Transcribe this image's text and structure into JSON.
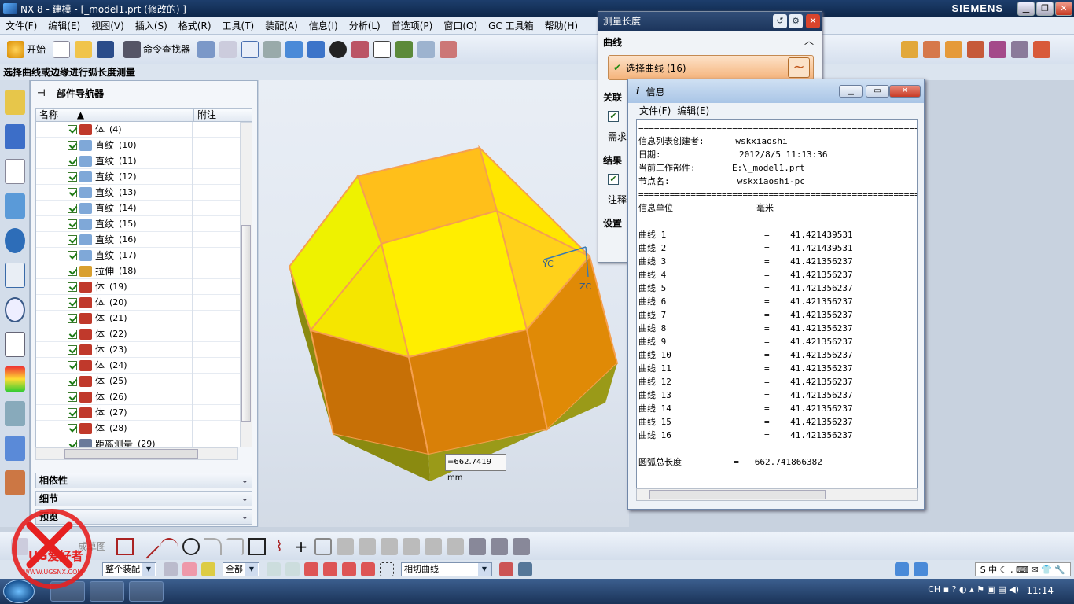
{
  "window": {
    "title": "NX 8 - 建模 - [_model1.prt (修改的) ]",
    "brand": "SIEMENS"
  },
  "menus": [
    "文件(F)",
    "编辑(E)",
    "视图(V)",
    "插入(S)",
    "格式(R)",
    "工具(T)",
    "装配(A)",
    "信息(I)",
    "分析(L)",
    "首选项(P)",
    "窗口(O)",
    "GC 工具箱",
    "帮助(H)"
  ],
  "toolbar": {
    "start_label": "开始",
    "command_finder_label": "命令查找器"
  },
  "status_prompt": "选择曲线或边缘进行弧长度测量",
  "navigator": {
    "title": "部件导航器",
    "col_name": "名称",
    "col_note": "附注",
    "rows": [
      {
        "label": "体",
        "id": "(4)",
        "kind": "body"
      },
      {
        "label": "直纹",
        "id": "(10)",
        "kind": "ruled"
      },
      {
        "label": "直纹",
        "id": "(11)",
        "kind": "ruled"
      },
      {
        "label": "直纹",
        "id": "(12)",
        "kind": "ruled"
      },
      {
        "label": "直纹",
        "id": "(13)",
        "kind": "ruled"
      },
      {
        "label": "直纹",
        "id": "(14)",
        "kind": "ruled"
      },
      {
        "label": "直纹",
        "id": "(15)",
        "kind": "ruled"
      },
      {
        "label": "直纹",
        "id": "(16)",
        "kind": "ruled"
      },
      {
        "label": "直纹",
        "id": "(17)",
        "kind": "ruled"
      },
      {
        "label": "拉伸",
        "id": "(18)",
        "kind": "extrude"
      },
      {
        "label": "体",
        "id": "(19)",
        "kind": "body"
      },
      {
        "label": "体",
        "id": "(20)",
        "kind": "body"
      },
      {
        "label": "体",
        "id": "(21)",
        "kind": "body"
      },
      {
        "label": "体",
        "id": "(22)",
        "kind": "body"
      },
      {
        "label": "体",
        "id": "(23)",
        "kind": "body"
      },
      {
        "label": "体",
        "id": "(24)",
        "kind": "body"
      },
      {
        "label": "体",
        "id": "(25)",
        "kind": "body"
      },
      {
        "label": "体",
        "id": "(26)",
        "kind": "body"
      },
      {
        "label": "体",
        "id": "(27)",
        "kind": "body"
      },
      {
        "label": "体",
        "id": "(28)",
        "kind": "body"
      },
      {
        "label": "距离测量",
        "id": "(29)",
        "kind": "measure"
      }
    ],
    "panels": [
      "相依性",
      "细节",
      "预览"
    ]
  },
  "measure_dialog": {
    "title": "测量长度",
    "section_curve": "曲线",
    "select_curve": "选择曲线 (16)",
    "section_assoc": "关联",
    "need_label": "需求",
    "section_result": "结果",
    "note_label": "注释",
    "settings_label": "设置"
  },
  "viewport": {
    "measure_label": "=662.7419 mm",
    "axis_yc": "YC",
    "axis_zc": "ZC"
  },
  "info_window": {
    "title": "信息",
    "menu_file": "文件(F)",
    "menu_edit": "编辑(E)",
    "separator": "=============================================================",
    "creator_label": "信息列表创建者:",
    "creator": "wskxiaoshi",
    "date_label": "日期:",
    "date": "2012/8/5 11:13:36",
    "part_label": "当前工作部件:",
    "part": "E:\\_model1.prt",
    "node_label": "节点名:",
    "node": "wskxiaoshi-pc",
    "units_label": "信息单位",
    "units": "毫米",
    "curves": [
      {
        "name": "曲线 1",
        "value": "41.421439531"
      },
      {
        "name": "曲线 2",
        "value": "41.421439531"
      },
      {
        "name": "曲线 3",
        "value": "41.421356237"
      },
      {
        "name": "曲线 4",
        "value": "41.421356237"
      },
      {
        "name": "曲线 5",
        "value": "41.421356237"
      },
      {
        "name": "曲线 6",
        "value": "41.421356237"
      },
      {
        "name": "曲线 7",
        "value": "41.421356237"
      },
      {
        "name": "曲线 8",
        "value": "41.421356237"
      },
      {
        "name": "曲线 9",
        "value": "41.421356237"
      },
      {
        "name": "曲线 10",
        "value": "41.421356237"
      },
      {
        "name": "曲线 11",
        "value": "41.421356237"
      },
      {
        "name": "曲线 12",
        "value": "41.421356237"
      },
      {
        "name": "曲线 13",
        "value": "41.421356237"
      },
      {
        "name": "曲线 14",
        "value": "41.421356237"
      },
      {
        "name": "曲线 15",
        "value": "41.421356237"
      },
      {
        "name": "曲线 16",
        "value": "41.421356237"
      }
    ],
    "total_label": "圆弧总长度",
    "total": "662.741866382"
  },
  "bottom": {
    "sketch_label": "成草图",
    "assembly_combo": "整个装配",
    "filter_combo": "全部",
    "snap_combo": "相切曲线"
  },
  "taskbar": {
    "lang": "CH",
    "time": "11:14"
  },
  "watermark": {
    "text": "UG爱好者",
    "url": "WWW.UGSNX.COM"
  },
  "colors": {
    "title_blue": "#1c355c",
    "model_yellow": "#ffcc00",
    "model_orange": "#d87a08",
    "highlight_orange": "#f5a050"
  }
}
